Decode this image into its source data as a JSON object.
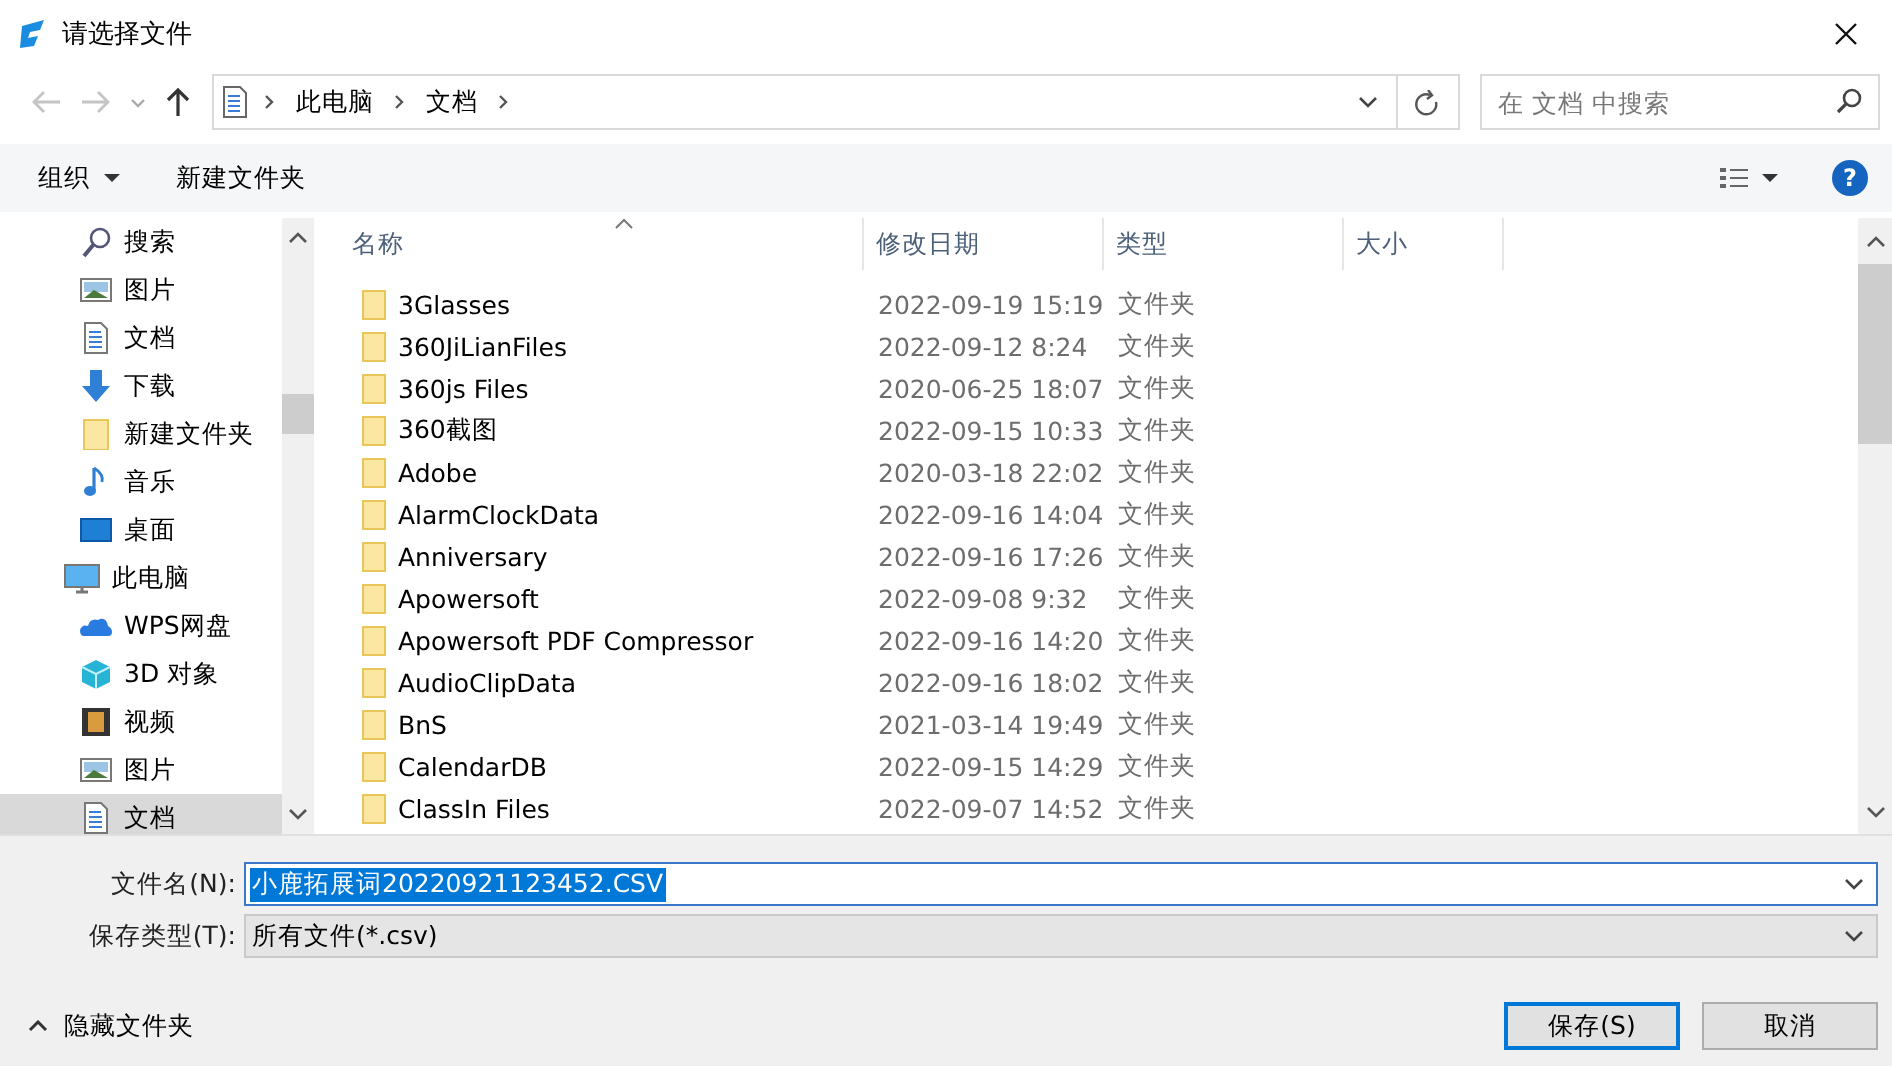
{
  "window": {
    "title": "请选择文件"
  },
  "nav": {
    "back": {
      "disabled": true
    },
    "forward": {
      "disabled": true
    },
    "up": {
      "disabled": false
    },
    "breadcrumbs": [
      "此电脑",
      "文档"
    ],
    "search": {
      "placeholder": "在 文档 中搜索"
    }
  },
  "toolbar": {
    "organize": "组织",
    "new_folder": "新建文件夹",
    "help": "?"
  },
  "sidebar": {
    "items": [
      {
        "label": "搜索",
        "kind": "search",
        "selected": false
      },
      {
        "label": "图片",
        "kind": "pictures",
        "selected": false
      },
      {
        "label": "文档",
        "kind": "documents",
        "selected": false
      },
      {
        "label": "下载",
        "kind": "downloads",
        "selected": false
      },
      {
        "label": "新建文件夹",
        "kind": "folder",
        "selected": false
      },
      {
        "label": "音乐",
        "kind": "music",
        "selected": false
      },
      {
        "label": "桌面",
        "kind": "desktop",
        "selected": false
      },
      {
        "label": "此电脑",
        "kind": "computer",
        "selected": false,
        "children": [
          {
            "label": "WPS网盘",
            "kind": "cloud",
            "selected": false
          },
          {
            "label": "3D 对象",
            "kind": "cube",
            "selected": false
          },
          {
            "label": "视频",
            "kind": "videos",
            "selected": false
          },
          {
            "label": "图片",
            "kind": "pictures",
            "selected": false
          },
          {
            "label": "文档",
            "kind": "documents",
            "selected": true
          }
        ]
      }
    ]
  },
  "table": {
    "columns": [
      "名称",
      "修改日期",
      "类型",
      "大小"
    ],
    "rows": [
      {
        "name": "3Glasses",
        "modified": "2022-09-19 15:19",
        "type": "文件夹"
      },
      {
        "name": "360JiLianFiles",
        "modified": "2022-09-12 8:24",
        "type": "文件夹"
      },
      {
        "name": "360js Files",
        "modified": "2020-06-25 18:07",
        "type": "文件夹"
      },
      {
        "name": "360截图",
        "modified": "2022-09-15 10:33",
        "type": "文件夹"
      },
      {
        "name": "Adobe",
        "modified": "2020-03-18 22:02",
        "type": "文件夹"
      },
      {
        "name": "AlarmClockData",
        "modified": "2022-09-16 14:04",
        "type": "文件夹"
      },
      {
        "name": "Anniversary",
        "modified": "2022-09-16 17:26",
        "type": "文件夹"
      },
      {
        "name": "Apowersoft",
        "modified": "2022-09-08 9:32",
        "type": "文件夹"
      },
      {
        "name": "Apowersoft PDF Compressor",
        "modified": "2022-09-16 14:20",
        "type": "文件夹"
      },
      {
        "name": "AudioClipData",
        "modified": "2022-09-16 18:02",
        "type": "文件夹"
      },
      {
        "name": "BnS",
        "modified": "2021-03-14 19:49",
        "type": "文件夹"
      },
      {
        "name": "CalendarDB",
        "modified": "2022-09-15 14:29",
        "type": "文件夹"
      },
      {
        "name": "ClassIn Files",
        "modified": "2022-09-07 14:52",
        "type": "文件夹"
      }
    ]
  },
  "footer": {
    "file_name": {
      "label": "文件名(N):",
      "value": "小鹿拓展词20220921123452.CSV",
      "value_selected": true
    },
    "file_type": {
      "label": "保存类型(T):",
      "value": "所有文件(*.csv)"
    },
    "hide_folders": "隐藏文件夹",
    "buttons": [
      {
        "label": "保存(S)",
        "default": true
      },
      {
        "label": "取消",
        "default": false
      }
    ]
  }
}
